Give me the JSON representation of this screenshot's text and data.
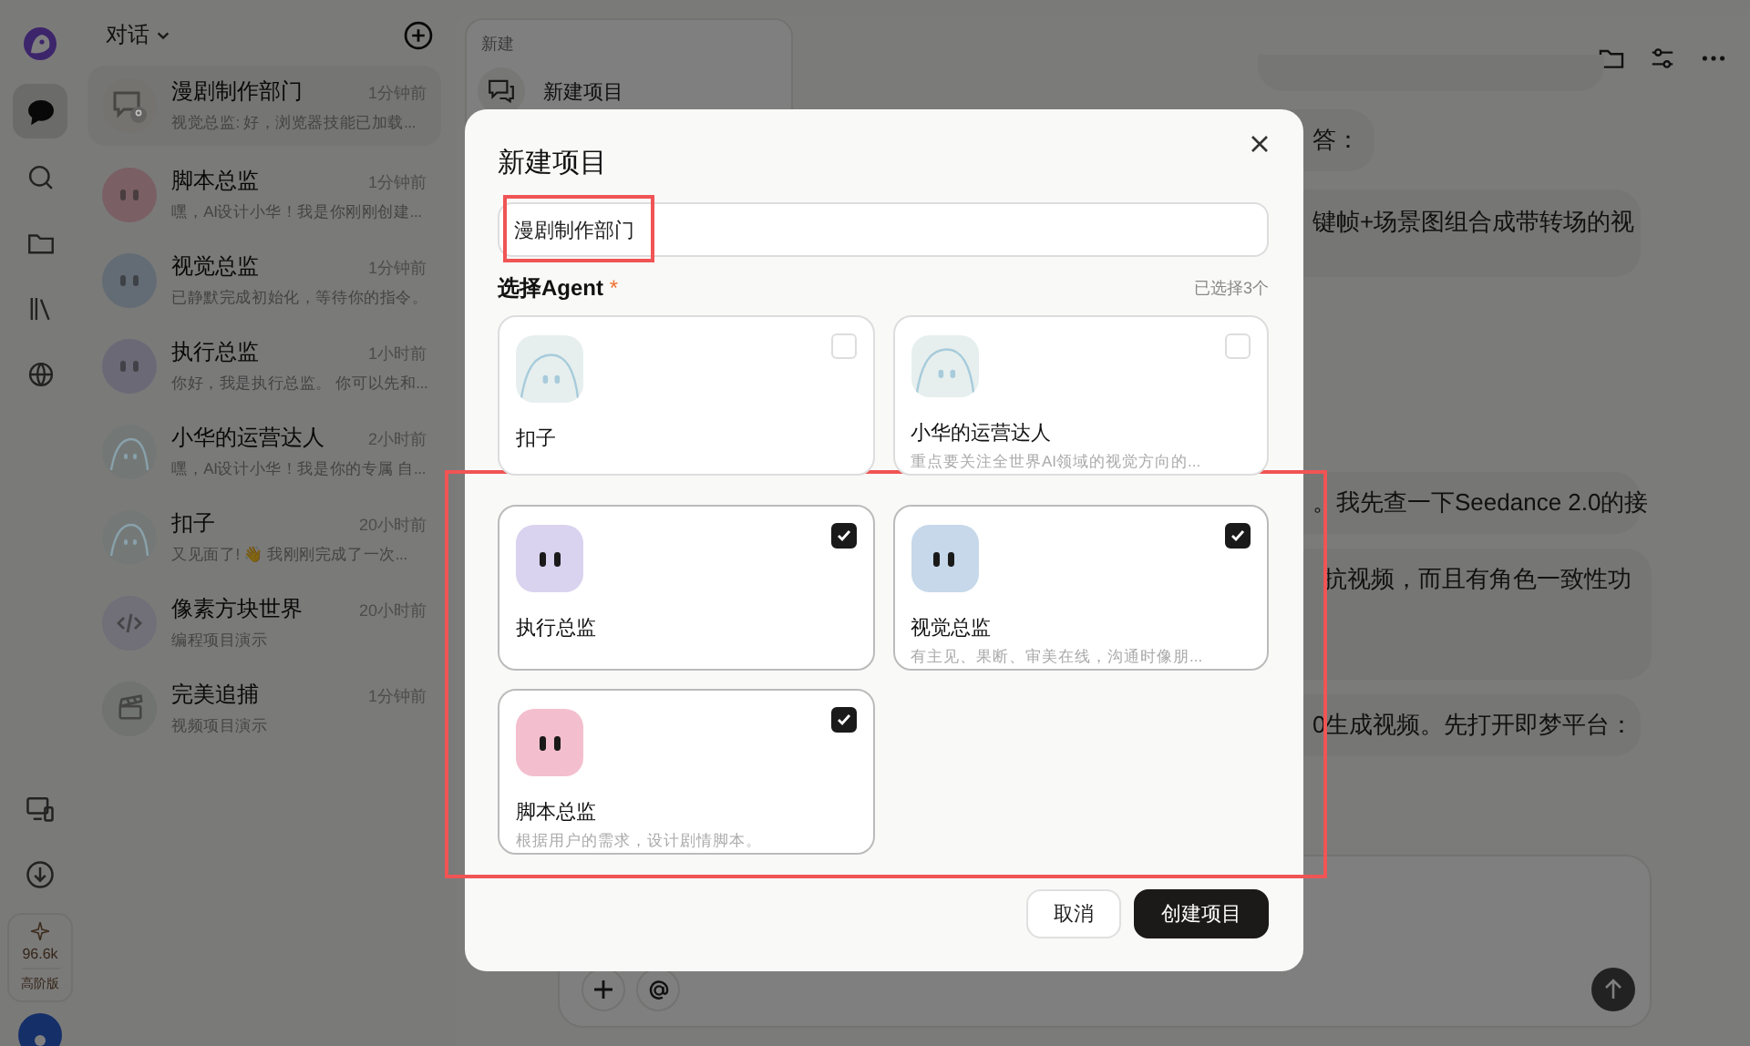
{
  "rail": {
    "items": [
      {
        "kind": "chat",
        "selected": true
      },
      {
        "kind": "search",
        "selected": false
      },
      {
        "kind": "folder",
        "selected": false
      },
      {
        "kind": "library",
        "selected": false
      },
      {
        "kind": "globe",
        "selected": false
      }
    ],
    "credits": {
      "amount": "96.6k",
      "plan": "高阶版"
    }
  },
  "conversations": {
    "title": "对话",
    "items": [
      {
        "title": "漫剧制作部门",
        "time": "1分钟前",
        "preview": "视觉总监: 好，浏览器技能已加载...",
        "kind": "group",
        "color": "#75736f",
        "selected": true
      },
      {
        "title": "脚本总监",
        "time": "1分钟前",
        "preview": "嘿，AI设计小华！我是你刚刚创建...",
        "kind": "blob",
        "color": "#7a5f64",
        "selected": false
      },
      {
        "title": "视觉总监",
        "time": "1分钟前",
        "preview": "已静默完成初始化，等待你的指令。",
        "kind": "blob",
        "color": "#636c75",
        "selected": false
      },
      {
        "title": "执行总监",
        "time": "1小时前",
        "preview": "你好，我是执行总监。 你可以先和...",
        "kind": "blob",
        "color": "#6c6977",
        "selected": false
      },
      {
        "title": "小华的运营达人",
        "time": "2小时前",
        "preview": "嘿，AI设计小华！我是你的专属 自...",
        "kind": "ghost",
        "color": "#737877",
        "selected": false
      },
      {
        "title": "扣子",
        "time": "20小时前",
        "preview": "又见面了! 👋 我刚刚完成了一次...",
        "kind": "ghost",
        "color": "#747978",
        "selected": false
      },
      {
        "title": "像素方块世界",
        "time": "20小时前",
        "preview": "编程项目演示",
        "kind": "code",
        "color": "#716f77",
        "selected": false
      },
      {
        "title": "完美追捕",
        "time": "1分钟前",
        "preview": "视频项目演示",
        "kind": "clapper",
        "color": "#717370",
        "selected": false
      }
    ]
  },
  "new_menu": {
    "heading": "新建",
    "item": "新建项目"
  },
  "chat": {
    "messages": [
      "答：",
      "键帧+场景图组合成带转场的视",
      "。我先查一下Seedance 2.0的接",
      "抗视频，而且有角色一致性功",
      "0生成视频。先打开即梦平台："
    ]
  },
  "dialog": {
    "title": "新建项目",
    "name_value": "漫剧制作部门",
    "agent_label": "选择Agent",
    "required_mark": "*",
    "selected_count": "已选择3个",
    "agents": [
      {
        "name": "扣子",
        "kind": "ghost",
        "color": "#e6efee",
        "checked": false
      },
      {
        "name": "小华的运营达人",
        "description": "重点要关注全世界AI领域的视觉方向的...",
        "kind": "ghost",
        "color": "#e6efee",
        "checked": false
      },
      {
        "name": "执行总监",
        "kind": "blob",
        "color": "#d9d3ef",
        "checked": true
      },
      {
        "name": "视觉总监",
        "description": "有主见、果断、审美在线，沟通时像朋...",
        "kind": "blob",
        "color": "#c6d8ea",
        "checked": true
      },
      {
        "name": "脚本总监",
        "description": "根据用户的需求，设计剧情脚本。",
        "kind": "blob",
        "color": "#f3bfcf",
        "checked": true
      }
    ],
    "cancel": "取消",
    "create": "创建项目"
  }
}
